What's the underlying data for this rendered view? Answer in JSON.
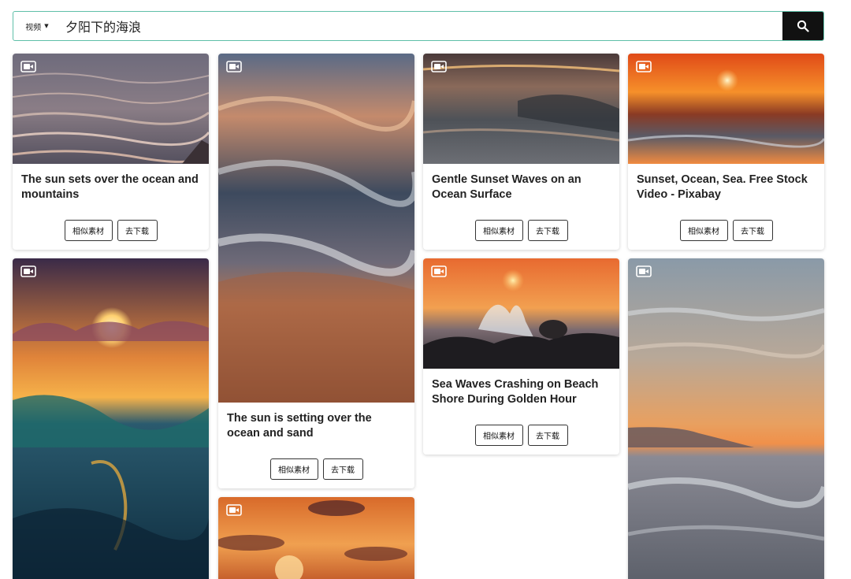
{
  "search": {
    "type_label": "视频",
    "query": "夕阳下的海浪"
  },
  "cards": [
    {
      "title": "The sun sets over the ocean and mountains",
      "similar": "相似素材",
      "download": "去下载"
    },
    {
      "title": "The sun is setting over the ocean and sand",
      "similar": "相似素材",
      "download": "去下载"
    },
    {
      "title": "Gentle Sunset Waves on an Ocean Surface",
      "similar": "相似素材",
      "download": "去下载"
    },
    {
      "title": "Sunset, Ocean, Sea. Free Stock Video - Pixabay",
      "similar": "相似素材",
      "download": "去下载"
    },
    {
      "title": "Sea Waves Crashing on Beach Shore During Golden Hour",
      "similar": "相似素材",
      "download": "去下载"
    }
  ],
  "colors": {
    "search_border": "#5fbfa8",
    "search_button": "#111111"
  },
  "icons": {
    "search": "search-icon",
    "video": "video-camera-icon",
    "caret": "caret-down-icon"
  }
}
